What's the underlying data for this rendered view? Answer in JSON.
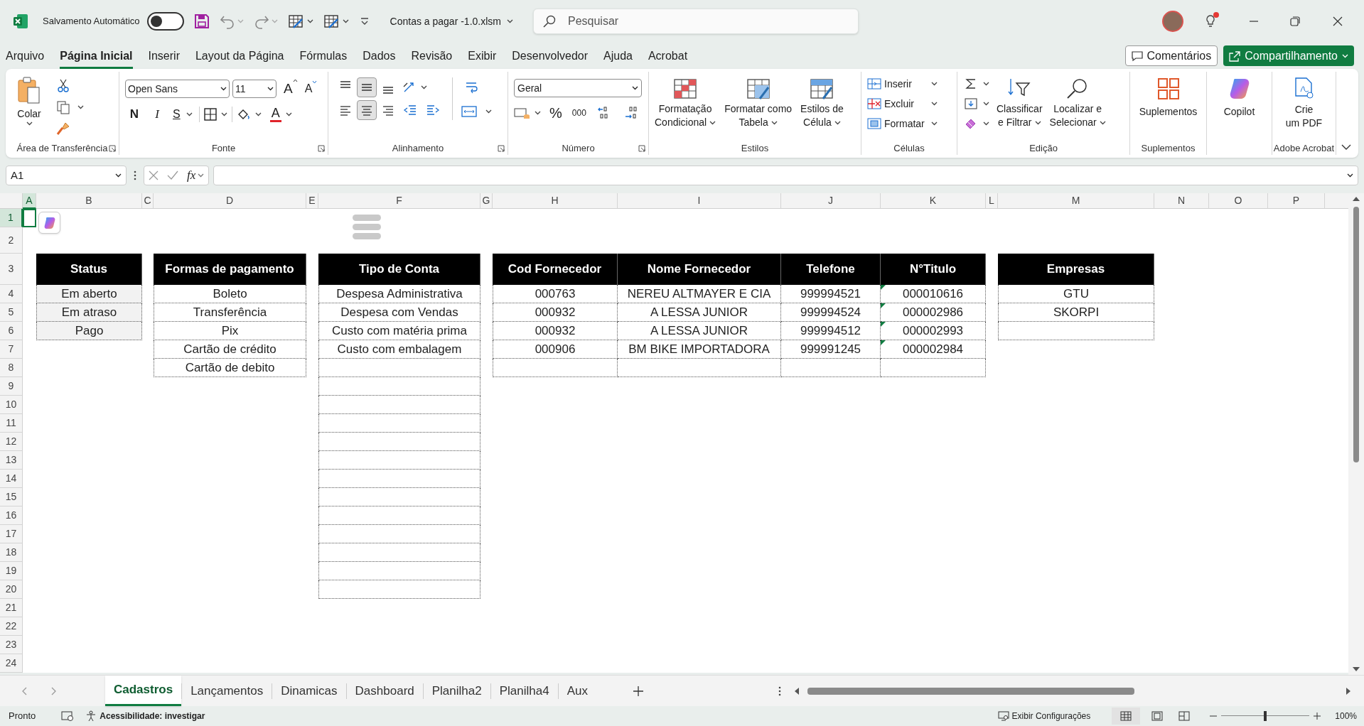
{
  "title_bar": {
    "autosave_label": "Salvamento Automático",
    "autosave_on": false,
    "file_name": "Contas a pagar -1.0.xlsm",
    "search_placeholder": "Pesquisar",
    "notification": true
  },
  "menu_tabs": [
    {
      "label": "Arquivo",
      "selected": false
    },
    {
      "label": "Página Inicial",
      "selected": true
    },
    {
      "label": "Inserir",
      "selected": false
    },
    {
      "label": "Layout da Página",
      "selected": false
    },
    {
      "label": "Fórmulas",
      "selected": false
    },
    {
      "label": "Dados",
      "selected": false
    },
    {
      "label": "Revisão",
      "selected": false
    },
    {
      "label": "Exibir",
      "selected": false
    },
    {
      "label": "Desenvolvedor",
      "selected": false
    },
    {
      "label": "Ajuda",
      "selected": false
    },
    {
      "label": "Acrobat",
      "selected": false
    }
  ],
  "comments_button": "Comentários",
  "share_button": "Compartilhamento",
  "ribbon": {
    "groups": [
      {
        "kind": "clipboard",
        "label": "Área de Transferência",
        "paste": "Colar",
        "launcher": true
      },
      {
        "kind": "font",
        "label": "Fonte",
        "font_name": "Open Sans",
        "font_size": "11",
        "grow": "A",
        "shrink": "A",
        "bold": "N",
        "italic": "I",
        "underline": "S",
        "font_color": "A",
        "launcher": true
      },
      {
        "kind": "alignment",
        "label": "Alinhamento",
        "middle_pressed": true,
        "center_pressed": true,
        "launcher": true
      },
      {
        "kind": "number",
        "label": "Número",
        "format": "Geral",
        "percent": "%",
        "thousands": "000",
        "launcher": true
      },
      {
        "kind": "styles",
        "label": "Estilos",
        "buttons": [
          {
            "lines": [
              "Formatação",
              "Condicional"
            ]
          },
          {
            "lines": [
              "Formatar como",
              "Tabela"
            ]
          },
          {
            "lines": [
              "Estilos de",
              "Célula"
            ]
          }
        ]
      },
      {
        "kind": "cells",
        "label": "Células",
        "buttons": [
          "Inserir",
          "Excluir",
          "Formatar"
        ]
      },
      {
        "kind": "editing",
        "label": "Edição",
        "buttons": [
          {
            "lines": [
              "Classificar",
              "e Filtrar"
            ]
          },
          {
            "lines": [
              "Localizar e",
              "Selecionar"
            ]
          }
        ]
      },
      {
        "kind": "addins",
        "label": "Suplementos",
        "button": "Suplementos"
      },
      {
        "kind": "copilot",
        "button": "Copilot"
      },
      {
        "kind": "acrobat",
        "label": "Adobe Acrobat",
        "lines": [
          "Crie",
          "um PDF"
        ]
      }
    ]
  },
  "formula_bar": {
    "name_box": "A1",
    "fx": "fx"
  },
  "sheet": {
    "columns": [
      {
        "label": "A",
        "selected": true
      },
      {
        "label": "B",
        "selected": false
      },
      {
        "label": "C",
        "selected": false
      },
      {
        "label": "D",
        "selected": false
      },
      {
        "label": "E",
        "selected": false
      },
      {
        "label": "F",
        "selected": false
      },
      {
        "label": "G",
        "selected": false
      },
      {
        "label": "H",
        "selected": false
      },
      {
        "label": "I",
        "selected": false
      },
      {
        "label": "J",
        "selected": false
      },
      {
        "label": "K",
        "selected": false
      },
      {
        "label": "L",
        "selected": false
      },
      {
        "label": "M",
        "selected": false
      },
      {
        "label": "N",
        "selected": false
      },
      {
        "label": "O",
        "selected": false
      },
      {
        "label": "P",
        "selected": false
      }
    ],
    "rows": [
      {
        "label": "1",
        "selected": true
      },
      {
        "label": "2",
        "selected": false
      },
      {
        "label": "3",
        "selected": false
      },
      {
        "label": "4",
        "selected": false
      },
      {
        "label": "5",
        "selected": false
      },
      {
        "label": "6",
        "selected": false
      },
      {
        "label": "7",
        "selected": false
      },
      {
        "label": "8",
        "selected": false
      },
      {
        "label": "9",
        "selected": false
      },
      {
        "label": "10",
        "selected": false
      },
      {
        "label": "11",
        "selected": false
      },
      {
        "label": "12",
        "selected": false
      },
      {
        "label": "13",
        "selected": false
      },
      {
        "label": "14",
        "selected": false
      },
      {
        "label": "15",
        "selected": false
      },
      {
        "label": "16",
        "selected": false
      },
      {
        "label": "17",
        "selected": false
      },
      {
        "label": "18",
        "selected": false
      },
      {
        "label": "19",
        "selected": false
      },
      {
        "label": "20",
        "selected": false
      },
      {
        "label": "21",
        "selected": false
      },
      {
        "label": "22",
        "selected": false
      },
      {
        "label": "23",
        "selected": false
      },
      {
        "label": "24",
        "selected": false
      }
    ],
    "tables": [
      {
        "header": [
          "Status"
        ],
        "shaded": true,
        "rows": [
          {
            "cells": [
              "Em aberto"
            ]
          },
          {
            "cells": [
              "Em atraso"
            ]
          },
          {
            "cells": [
              "Pago"
            ]
          }
        ]
      },
      {
        "header": [
          "Formas de pagamento"
        ],
        "shaded": false,
        "rows": [
          {
            "cells": [
              "Boleto"
            ]
          },
          {
            "cells": [
              "Transferência"
            ]
          },
          {
            "cells": [
              "Pix"
            ]
          },
          {
            "cells": [
              "Cartão de crédito"
            ]
          },
          {
            "cells": [
              "Cartão de debito"
            ]
          }
        ]
      },
      {
        "header": [
          "Tipo de Conta"
        ],
        "shaded": false,
        "rows": [
          {
            "cells": [
              "Despesa Administrativa"
            ]
          },
          {
            "cells": [
              "Despesa com Vendas"
            ]
          },
          {
            "cells": [
              "Custo com matéria prima"
            ]
          },
          {
            "cells": [
              "Custo com embalagem"
            ]
          }
        ]
      },
      {
        "header": [
          "Cod Fornecedor",
          "Nome Fornecedor",
          "Telefone",
          "N°Titulo"
        ],
        "shaded": false,
        "rows": [
          {
            "cells": [
              "000763",
              "NEREU ALTMAYER E CIA",
              "999994521",
              "000010616"
            ],
            "flagged": true
          },
          {
            "cells": [
              "000932",
              "A LESSA JUNIOR",
              "999994524",
              "000002986"
            ],
            "flagged": true
          },
          {
            "cells": [
              "000932",
              "A LESSA JUNIOR",
              "999994512",
              "000002993"
            ],
            "flagged": true
          },
          {
            "cells": [
              "000906",
              "BM BIKE IMPORTADORA",
              "999991245",
              "000002984"
            ],
            "flagged": true
          }
        ]
      },
      {
        "header": [
          "Empresas"
        ],
        "shaded": false,
        "rows": [
          {
            "cells": [
              "GTU"
            ]
          },
          {
            "cells": [
              "SKORPI"
            ]
          }
        ]
      }
    ]
  },
  "sheet_tabs": [
    {
      "label": "Cadastros",
      "selected": true
    },
    {
      "label": "Lançamentos",
      "selected": false
    },
    {
      "label": "Dinamicas",
      "selected": false
    },
    {
      "label": "Dashboard",
      "selected": false
    },
    {
      "label": "Planilha2",
      "selected": false
    },
    {
      "label": "Planilha4",
      "selected": false
    },
    {
      "label": "Aux",
      "selected": false
    }
  ],
  "status_bar": {
    "ready": "Pronto",
    "accessibility": "Acessibilidade: investigar",
    "display_settings": "Exibir Configurações",
    "zoom": "100%",
    "zoom_slider": {
      "level": 0.5
    }
  }
}
